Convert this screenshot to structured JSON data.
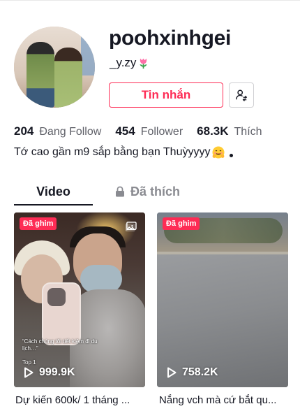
{
  "profile": {
    "username": "poohxinhgei",
    "nickname": "_y.zy",
    "nickname_emoji": "tulip-icon",
    "bio": "Tớ cao gần m9 sắp bằng bạn Thuỳyyyy",
    "bio_emoji": "hugging-face-icon"
  },
  "actions": {
    "message_label": "Tin nhắn",
    "follow_icon": "add-friend-icon"
  },
  "stats": {
    "following_count": "204",
    "following_label": "Đang Follow",
    "followers_count": "454",
    "followers_label": "Follower",
    "likes_count": "68.3K",
    "likes_label": "Thích"
  },
  "tabs": [
    {
      "label": "Video",
      "active": true
    },
    {
      "label": "Đã thích",
      "active": false,
      "icon": "lock-icon"
    }
  ],
  "videos": [
    {
      "pinned_label": "Đã ghim",
      "type_icon": "photo-carousel-icon",
      "overlay_caption": "“Cách chúng tôi tiết kiệm đi du lịch…”",
      "overlay_top": "Top 1",
      "views": "999.9K",
      "description": "Dự kiến 600k/ 1 tháng ..."
    },
    {
      "pinned_label": "Đã ghim",
      "views": "758.2K",
      "description": "Nắng vch mà cứ bắt qu..."
    }
  ],
  "colors": {
    "accent": "#fe2c55",
    "text_primary": "#161823",
    "text_secondary": "#5f6068",
    "tab_inactive": "#8a8b91"
  }
}
